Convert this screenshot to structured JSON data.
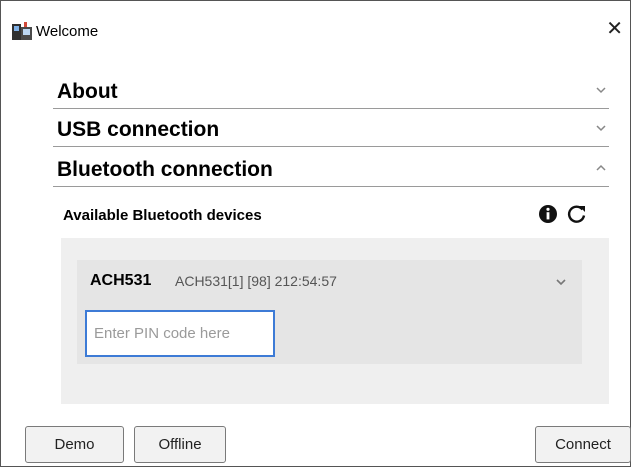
{
  "window": {
    "title": "Welcome",
    "close_glyph": "✕"
  },
  "sections": [
    {
      "label": "About",
      "state": "collapsed"
    },
    {
      "label": "USB connection",
      "state": "collapsed"
    },
    {
      "label": "Bluetooth connection",
      "state": "expanded"
    }
  ],
  "bluetooth": {
    "available_label": "Available Bluetooth devices",
    "device": {
      "name": "ACH531",
      "details": "ACH531[1] [98] 212:54:57",
      "pin_value": "",
      "pin_placeholder": "Enter PIN code here"
    }
  },
  "buttons": {
    "demo": "Demo",
    "offline": "Offline",
    "connect": "Connect"
  },
  "icons": {
    "info": "info-icon",
    "refresh": "refresh-icon",
    "chevron_down": "chevron-down-icon",
    "chevron_up": "chevron-up-icon"
  },
  "colors": {
    "focus": "#3d7bd6",
    "panel": "#efefef",
    "device": "#e5e5e5"
  }
}
